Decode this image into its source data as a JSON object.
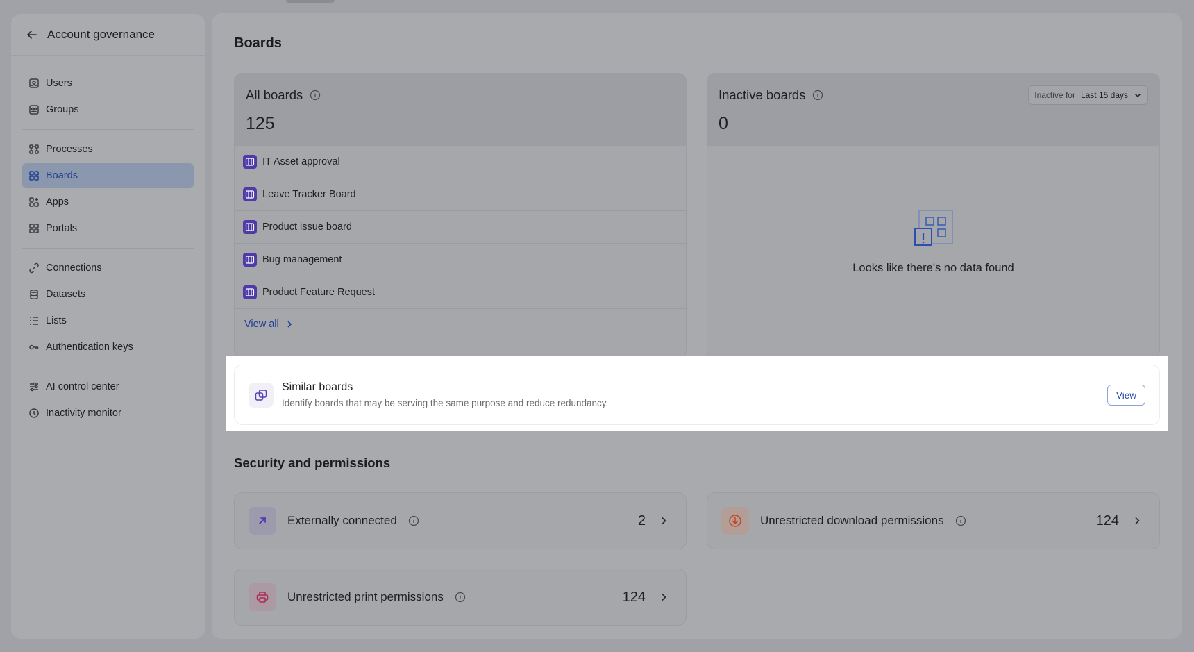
{
  "sidebar": {
    "title": "Account governance",
    "groups": [
      [
        {
          "label": "Users",
          "icon": "user-icon"
        },
        {
          "label": "Groups",
          "icon": "group-icon"
        }
      ],
      [
        {
          "label": "Processes",
          "icon": "process-icon"
        },
        {
          "label": "Boards",
          "icon": "boards-icon",
          "active": true
        },
        {
          "label": "Apps",
          "icon": "apps-icon"
        },
        {
          "label": "Portals",
          "icon": "portals-icon"
        }
      ],
      [
        {
          "label": "Connections",
          "icon": "connections-icon"
        },
        {
          "label": "Datasets",
          "icon": "datasets-icon"
        },
        {
          "label": "Lists",
          "icon": "lists-icon"
        },
        {
          "label": "Authentication keys",
          "icon": "key-icon"
        }
      ],
      [
        {
          "label": "AI control center",
          "icon": "sliders-icon"
        },
        {
          "label": "Inactivity monitor",
          "icon": "clock-icon"
        }
      ]
    ]
  },
  "main": {
    "title": "Boards",
    "all_boards": {
      "title": "All boards",
      "count": "125",
      "items": [
        "IT Asset approval",
        "Leave Tracker Board",
        "Product issue board",
        "Bug management",
        "Product Feature Request"
      ],
      "view_all": "View all"
    },
    "inactive_boards": {
      "title": "Inactive boards",
      "count": "0",
      "filter_label": "Inactive for",
      "filter_value": "Last 15 days",
      "empty_message": "Looks like there's no data found"
    },
    "similar": {
      "title": "Similar boards",
      "description": "Identify boards that may be serving the same purpose and reduce redundancy.",
      "button": "View"
    },
    "security": {
      "title": "Security and permissions",
      "items": [
        {
          "label": "Externally connected",
          "count": "2",
          "icon": "external-arrow-icon",
          "color": "#5a3fb8",
          "bg": "#9d9aae"
        },
        {
          "label": "Unrestricted download permissions",
          "count": "124",
          "icon": "download-icon",
          "color": "#c84a1a",
          "bg": "#b29e97"
        },
        {
          "label": "Unrestricted print permissions",
          "count": "124",
          "icon": "printer-icon",
          "color": "#b02a5a",
          "bg": "#ab9aa2"
        }
      ]
    }
  }
}
